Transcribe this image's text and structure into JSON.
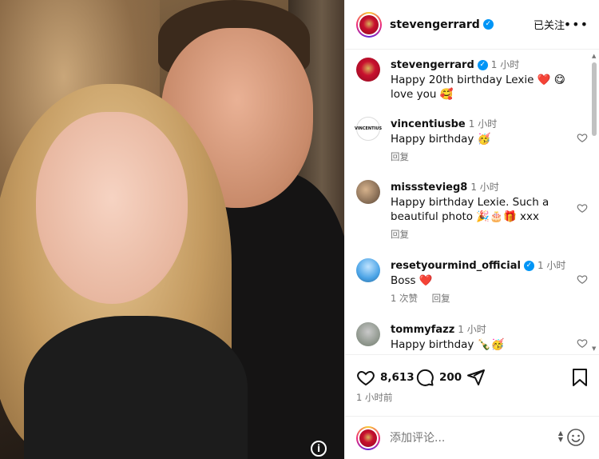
{
  "photo": {
    "info_icon": "i"
  },
  "post": {
    "username": "stevengerrard",
    "verified_icon": "verified-badge-icon",
    "follow_status": "已关注",
    "more_label": "•••"
  },
  "comments": [
    {
      "user": "stevengerrard",
      "time": "1 小时",
      "text": "Happy 20th birthday Lexie ❤️ 😋 love you 🥰",
      "likes": "",
      "reply": ""
    },
    {
      "user": "vincentiusbe",
      "avatar_text": "VINCENTIUS",
      "time": "1 小时",
      "text": "Happy birthday 🥳",
      "likes": "",
      "reply": "回复"
    },
    {
      "user": "missstevieg8",
      "time": "1 小时",
      "text": "Happy birthday Lexie. Such a beautiful photo 🎉🎂🎁 xxx",
      "likes": "",
      "reply": "回复"
    },
    {
      "user": "resetyourmind_official",
      "time": "1 小时",
      "text": "Boss ❤️",
      "likes": "1 次赞",
      "reply": "回复"
    },
    {
      "user": "tommyfazz",
      "time": "1 小时",
      "text": "Happy birthday 🍾🥳",
      "likes": "",
      "reply": ""
    }
  ],
  "actions": {
    "likes_count": "8,613",
    "comments_count": "200",
    "time_ago": "1 小时前"
  },
  "comment_box": {
    "placeholder": "添加评论..."
  },
  "colors": {
    "accent": "#0095f6",
    "heart_red": "#ed4956",
    "muted": "#737373"
  }
}
